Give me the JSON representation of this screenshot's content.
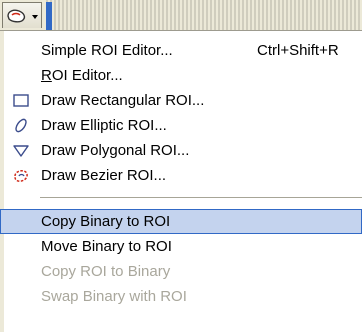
{
  "toolbar": {
    "roi_button_icon": "roi-tool-icon",
    "dropdown_arrow_icon": "chevron-down-icon"
  },
  "menu": {
    "items": [
      {
        "label": "Simple ROI Editor...",
        "shortcut": "Ctrl+Shift+R",
        "icon": null,
        "enabled": true
      },
      {
        "label": "ROI Editor...",
        "mnemonic": "R",
        "rest": "OI Editor...",
        "icon": null,
        "enabled": true
      },
      {
        "label": "Draw Rectangular ROI...",
        "icon": "rectangle-roi-icon",
        "enabled": true
      },
      {
        "label": "Draw Elliptic ROI...",
        "icon": "ellipse-roi-icon",
        "enabled": true
      },
      {
        "label": "Draw Polygonal ROI...",
        "icon": "polygon-roi-icon",
        "enabled": true
      },
      {
        "label": "Draw Bezier ROI...",
        "icon": "bezier-roi-icon",
        "enabled": true
      },
      {
        "label": "Copy Binary to ROI",
        "icon": null,
        "enabled": true,
        "highlighted": true
      },
      {
        "label": "Move Binary to ROI",
        "icon": null,
        "enabled": true
      },
      {
        "label": "Copy ROI to Binary",
        "icon": null,
        "enabled": false
      },
      {
        "label": "Swap Binary with ROI",
        "icon": null,
        "enabled": false
      }
    ]
  },
  "colors": {
    "highlight_bg": "#c4d3ee",
    "highlight_border": "#3169c6",
    "disabled_text": "#a9a79c",
    "icon_blue": "#3b4c8c",
    "icon_red": "#d02b1a"
  }
}
